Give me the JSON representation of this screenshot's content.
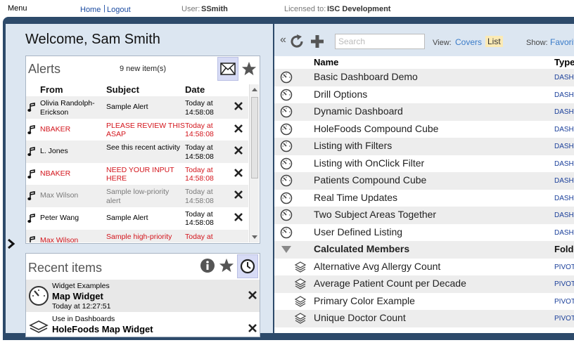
{
  "topbar": {
    "menu": "Menu",
    "home": "Home",
    "separator": "|",
    "logout": "Logout",
    "user_label": "User:",
    "user_value": "SSmith",
    "license_label": "Licensed to:",
    "license_value": "ISC Development"
  },
  "welcome": "Welcome, Sam Smith",
  "expander": "›",
  "alerts": {
    "title": "Alerts",
    "count": "9 new item(s)",
    "columns": {
      "from": "From",
      "subject": "Subject",
      "date": "Date"
    },
    "rows": [
      {
        "from": "Olivia Randolph-Erickson",
        "subject": "Sample Alert",
        "date": "Today at 14:58:08",
        "style": "normal"
      },
      {
        "from": "NBAKER",
        "subject": "PLEASE REVIEW THIS ASAP",
        "date": "Today at 14:58:08",
        "style": "red"
      },
      {
        "from": "L. Jones",
        "subject": "See this recent activity",
        "date": "Today at 14:58:08",
        "style": "normal"
      },
      {
        "from": "NBAKER",
        "subject": "NEED YOUR INPUT HERE",
        "date": "Today at 14:58:08",
        "style": "red"
      },
      {
        "from": "Max Wilson",
        "subject": "Sample low-priority alert",
        "date": "Today at 14:58:08",
        "style": "grey"
      },
      {
        "from": "Peter Wang",
        "subject": "Sample Alert",
        "date": "Today at 14:58:08",
        "style": "normal"
      },
      {
        "from": "Max Wilson",
        "subject": "Sample high-priority",
        "date": "Today at",
        "style": "red"
      }
    ]
  },
  "recent": {
    "title": "Recent items",
    "items": [
      {
        "type": "Widget Examples",
        "name": "Map Widget",
        "time": "Today at 12:27:51"
      },
      {
        "type": "Use in Dashboards",
        "name": "HoleFoods Map Widget",
        "time": ""
      }
    ]
  },
  "toolbar": {
    "back": "«",
    "search_placeholder": "Search",
    "view_label": "View:",
    "covers": "Covers",
    "list": "List",
    "show_label": "Show:",
    "favorites": "Favorites"
  },
  "columns": {
    "name": "Name",
    "type": "Type"
  },
  "dashboards": [
    {
      "name": "Basic Dashboard Demo",
      "type": "DASHBOARD"
    },
    {
      "name": "Drill Options",
      "type": "DASHBOARD"
    },
    {
      "name": "Dynamic Dashboard",
      "type": "DASHBOARD"
    },
    {
      "name": "HoleFoods Compound Cube",
      "type": "DASHBOARD"
    },
    {
      "name": "Listing with Filters",
      "type": "DASHBOARD"
    },
    {
      "name": "Listing with OnClick Filter",
      "type": "DASHBOARD"
    },
    {
      "name": "Patients Compound Cube",
      "type": "DASHBOARD"
    },
    {
      "name": "Real Time Updates",
      "type": "DASHBOARD"
    },
    {
      "name": "Two Subject Areas Together",
      "type": "DASHBOARD"
    },
    {
      "name": "User Defined Listing",
      "type": "DASHBOARD"
    }
  ],
  "group": {
    "name": "Calculated Members",
    "type": "Folder"
  },
  "pivots": [
    {
      "name": "Alternative Avg Allergy Count",
      "type": "PIVOT"
    },
    {
      "name": "Average Patient Count per Decade",
      "type": "PIVOT"
    },
    {
      "name": "Primary Color Example",
      "type": "PIVOT"
    },
    {
      "name": "Unique Doctor Count",
      "type": "PIVOT"
    }
  ],
  "colors": {
    "frame": "#2d4a6a",
    "panel_bg": "#dce6f1",
    "alert_red": "#d3151c",
    "link_blue": "#3b7cc9"
  }
}
